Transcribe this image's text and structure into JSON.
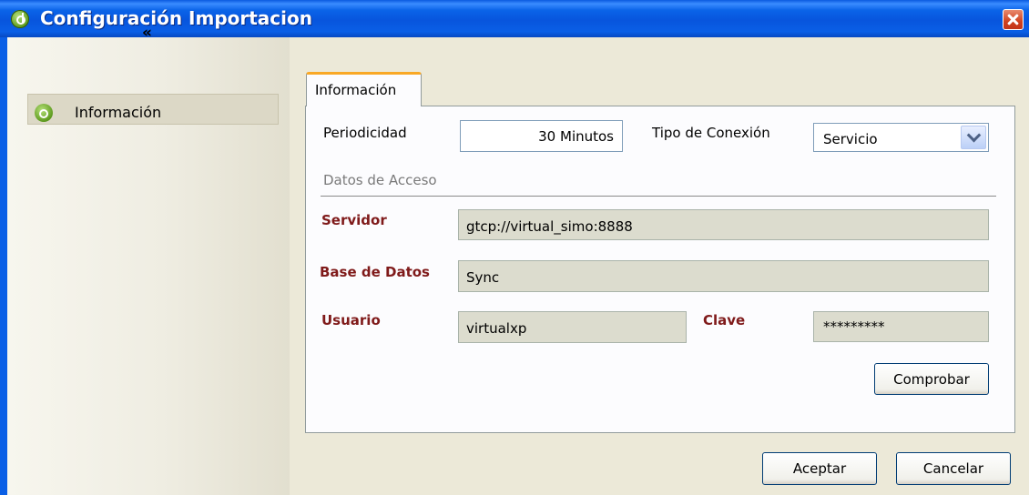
{
  "window": {
    "title": "Configuración Importacion",
    "close_icon": "close-icon"
  },
  "sidebar": {
    "collapse_label": "«",
    "items": [
      {
        "label": "Información",
        "icon": "app-logo-icon"
      }
    ]
  },
  "tabs": [
    {
      "label": "Información",
      "active": true
    }
  ],
  "form": {
    "periodicidad_label": "Periodicidad",
    "periodicidad_value": "30 Minutos",
    "tipo_conexion_label": "Tipo de Conexión",
    "tipo_conexion_value": "Servicio",
    "section_title": "Datos de Acceso",
    "servidor_label": "Servidor",
    "servidor_value": "gtcp://virtual_simo:8888",
    "base_datos_label": "Base de Datos",
    "base_datos_value": "Sync",
    "usuario_label": "Usuario",
    "usuario_value": "virtualxp",
    "clave_label": "Clave",
    "clave_value": "*********",
    "comprobar_label": "Comprobar"
  },
  "footer": {
    "aceptar_label": "Aceptar",
    "cancelar_label": "Cancelar"
  },
  "colors": {
    "title_bar": "#0a5fe6",
    "required_label": "#7f1a1a",
    "tab_accent": "#f9a825"
  }
}
